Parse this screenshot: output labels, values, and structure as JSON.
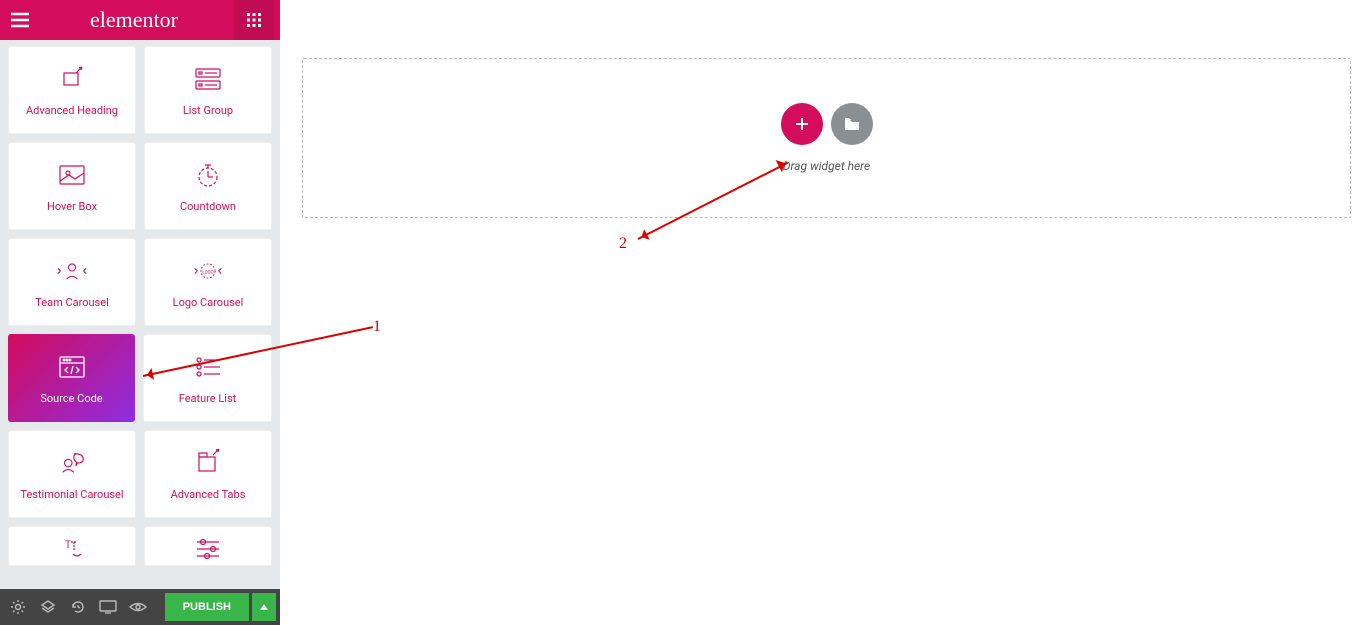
{
  "header": {
    "logo": "elementor"
  },
  "widgets": [
    {
      "label": "Advanced Heading",
      "icon": "advanced-heading"
    },
    {
      "label": "List Group",
      "icon": "list-group"
    },
    {
      "label": "Hover Box",
      "icon": "hover-box"
    },
    {
      "label": "Countdown",
      "icon": "countdown"
    },
    {
      "label": "Team Carousel",
      "icon": "team-carousel"
    },
    {
      "label": "Logo Carousel",
      "icon": "logo-carousel"
    },
    {
      "label": "Source Code",
      "icon": "source-code",
      "active": true
    },
    {
      "label": "Feature List",
      "icon": "feature-list"
    },
    {
      "label": "Testimonial Carousel",
      "icon": "testimonial-carousel"
    },
    {
      "label": "Advanced Tabs",
      "icon": "advanced-tabs"
    },
    {
      "label": "",
      "icon": "text-path-partial"
    },
    {
      "label": "",
      "icon": "sliders-partial"
    }
  ],
  "footer": {
    "publish": "PUBLISH"
  },
  "canvas": {
    "drag_hint": "Drag widget here"
  },
  "annotations": {
    "n1": "1",
    "n2": "2"
  },
  "colors": {
    "brand": "#d30c5c",
    "publish": "#39b54a"
  }
}
